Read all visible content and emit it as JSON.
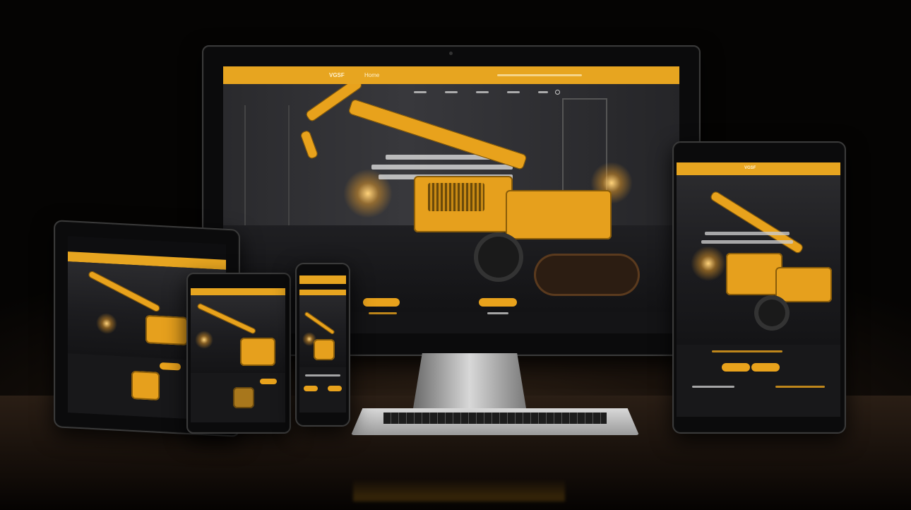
{
  "brand": {
    "accent": "#e8a21c",
    "dark": "#0e0e10"
  },
  "desktop": {
    "logo": "VGSF",
    "nav_label": "Home",
    "topbar_text": "",
    "nav_items": [
      "",
      "",
      "",
      "",
      ""
    ],
    "headline_lines": [
      "",
      "",
      ""
    ],
    "cta_left": "",
    "cta_right": ""
  },
  "tablet_right": {
    "logo": "VGSF"
  },
  "icons": [
    "search-icon",
    "camera-dot-icon"
  ]
}
